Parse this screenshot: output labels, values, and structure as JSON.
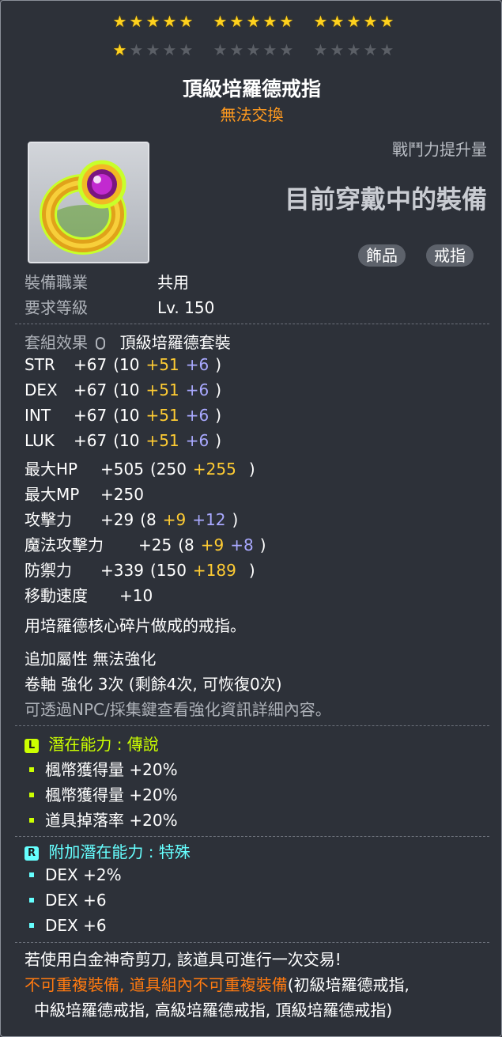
{
  "stars": {
    "row1": [
      5,
      5,
      5
    ],
    "row2_filled": 1,
    "row2": [
      5,
      5,
      5
    ]
  },
  "item": {
    "name": "頂級培羅德戒指",
    "tradeable": "無法交換",
    "cp_label": "戰鬥力提升量",
    "cp_value": "目前穿戴中的裝備",
    "tags": [
      "飾品",
      "戒指"
    ]
  },
  "req": [
    {
      "label": "裝備職業",
      "value": "共用"
    },
    {
      "label": "要求等級",
      "value": "Lv. 150"
    }
  ],
  "set": {
    "label": "套組效果",
    "value": "頂級培羅德套裝"
  },
  "stats": [
    {
      "name": "STR",
      "total": "+67",
      "base": "(10",
      "bonus": "+51",
      "star": "+6",
      "end": ")"
    },
    {
      "name": "DEX",
      "total": "+67",
      "base": "(10",
      "bonus": "+51",
      "star": "+6",
      "end": ")"
    },
    {
      "name": "INT",
      "total": "+67",
      "base": "(10",
      "bonus": "+51",
      "star": "+6",
      "end": ")"
    },
    {
      "name": "LUK",
      "total": "+67",
      "base": "(10",
      "bonus": "+51",
      "star": "+6",
      "end": ")"
    },
    {
      "name": "最大HP",
      "total": "+505",
      "base": "(250",
      "bonus": "+255",
      "star": "",
      "end": ")"
    },
    {
      "name": "最大MP",
      "total": "+250",
      "base": "",
      "bonus": "",
      "star": "",
      "end": ""
    },
    {
      "name": "攻擊力",
      "total": "+29",
      "base": "(8",
      "bonus": "+9",
      "star": "+12",
      "end": ")"
    },
    {
      "name": "魔法攻擊力",
      "total": "+25",
      "base": "(8",
      "bonus": "+9",
      "star": "+8",
      "end": ")"
    },
    {
      "name": "防禦力",
      "total": "+339",
      "base": "(150",
      "bonus": "+189",
      "star": "",
      "end": ")"
    },
    {
      "name": "移動速度",
      "total": "+10",
      "base": "",
      "bonus": "",
      "star": "",
      "end": ""
    }
  ],
  "description": "用培羅德核心碎片做成的戒指。",
  "enhance": {
    "line1": "追加屬性 無法強化",
    "line2": "卷軸 強化 3次 (剩餘4次, 可恢復0次)",
    "line3": "可透過NPC/採集鍵查看強化資訊詳細內容。"
  },
  "potential": {
    "grade_letter": "L",
    "title": "潛在能力 : 傳說",
    "lines": [
      "楓幣獲得量 +20%",
      "楓幣獲得量 +20%",
      "道具掉落率 +20%"
    ]
  },
  "bonus_potential": {
    "grade_letter": "R",
    "title": "附加潛在能力 : 特殊",
    "lines": [
      "DEX +2%",
      "DEX +6",
      "DEX +6"
    ]
  },
  "footer": {
    "scissors": "若使用白金神奇剪刀, 該道具可進行一次交易!",
    "unique_orange": "不可重複裝備, 道具組內不可重複裝備",
    "unique_white_1": "(初級培羅德戒指,",
    "unique_white_2": "中級培羅德戒指, 高級培羅德戒指, 頂級培羅德戒指)"
  },
  "colors": {
    "star_on": "#ffd21e",
    "tradeable": "#ff9a1f",
    "bonus": "#ffcc33",
    "star_bonus": "#a9a9ff",
    "legendary": "#ccff00",
    "unique": "#66ffff",
    "warning": "#ff7a10"
  }
}
